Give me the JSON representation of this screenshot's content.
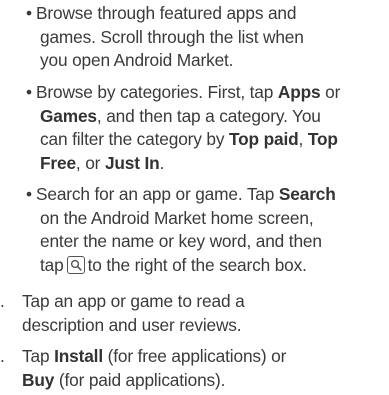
{
  "bullets": {
    "b1": {
      "bullet": "•",
      "l1": "Browse through featured apps and",
      "l2": "games. Scroll through the list when",
      "l3": "you open Android Market."
    },
    "b2": {
      "bullet": "•",
      "l1_pre": "Browse by categories. First, tap ",
      "l1_b1": "Apps",
      "l1_post": " or",
      "l2_b1": "Games",
      "l2_post": ", and then tap a category. You",
      "l3_pre": "can filter the category by ",
      "l3_b1": "Top paid",
      "l3_mid": ", ",
      "l3_b2": "Top",
      "l4_b1": "Free",
      "l4_mid": ", or ",
      "l4_b2": "Just In",
      "l4_post": "."
    },
    "b3": {
      "bullet": "•",
      "l1_pre": "Search for an app or game. Tap ",
      "l1_b1": "Search",
      "l2": "on the Android Market home screen,",
      "l3": "enter the name or key word, and then",
      "l4_pre": "tap",
      "l4_post": "to the right of the search box.",
      "search_icon": "search-icon"
    }
  },
  "steps": {
    "s1": {
      "num": ".",
      "l1": "Tap an app or game to read a",
      "l2": "description and user reviews."
    },
    "s2": {
      "num": ".",
      "l1_pre": "Tap ",
      "l1_b1": "Install",
      "l1_post": " (for free applications) or",
      "l2_b1": "Buy",
      "l2_post": " (for paid applications)."
    }
  }
}
